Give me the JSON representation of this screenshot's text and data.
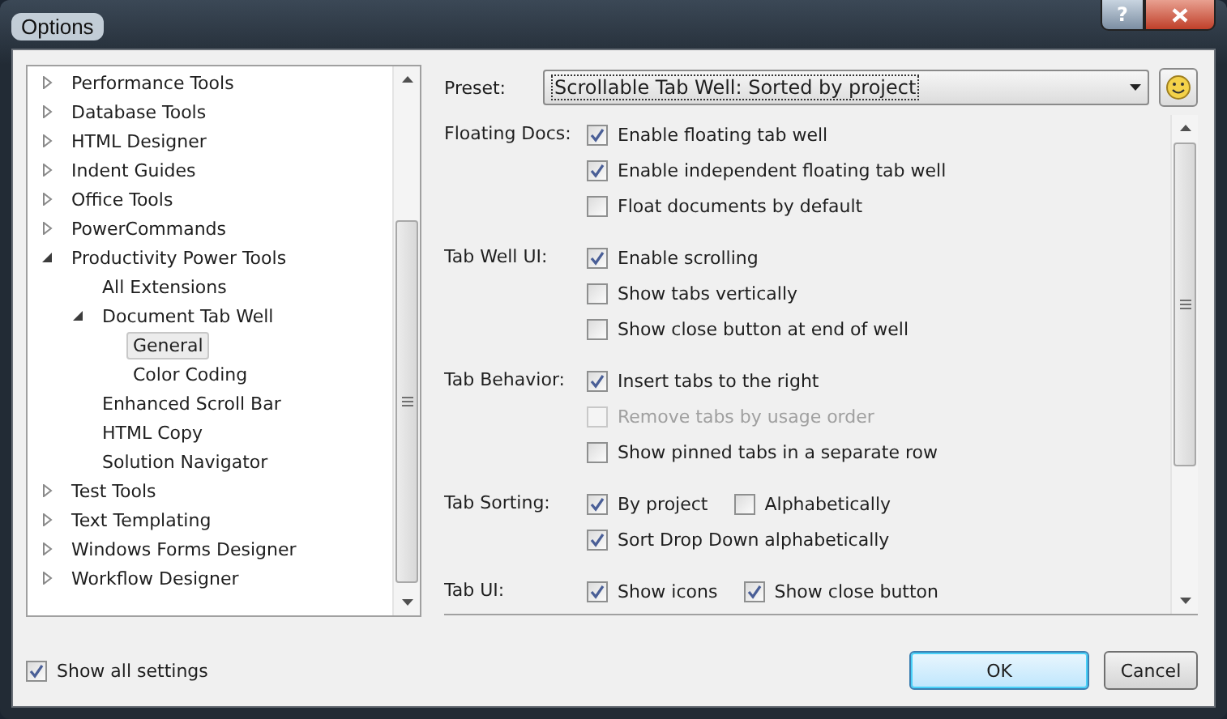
{
  "window": {
    "title": "Options",
    "help_button": "?"
  },
  "tree": [
    {
      "label": "Performance Tools",
      "expanded": false,
      "selected": false
    },
    {
      "label": "Database Tools",
      "expanded": false,
      "selected": false
    },
    {
      "label": "HTML Designer",
      "expanded": false,
      "selected": false
    },
    {
      "label": "Indent Guides",
      "expanded": false,
      "selected": false
    },
    {
      "label": "Office Tools",
      "expanded": false,
      "selected": false
    },
    {
      "label": "PowerCommands",
      "expanded": false,
      "selected": false
    },
    {
      "label": "Productivity Power Tools",
      "expanded": true,
      "selected": false,
      "children": [
        {
          "label": "All Extensions",
          "selected": false
        },
        {
          "label": "Document Tab Well",
          "expanded": true,
          "selected": false,
          "children": [
            {
              "label": "General",
              "selected": true
            },
            {
              "label": "Color Coding",
              "selected": false
            }
          ]
        },
        {
          "label": "Enhanced Scroll Bar",
          "selected": false
        },
        {
          "label": "HTML Copy",
          "selected": false
        },
        {
          "label": "Solution Navigator",
          "selected": false
        }
      ]
    },
    {
      "label": "Test Tools",
      "expanded": false,
      "selected": false
    },
    {
      "label": "Text Templating",
      "expanded": false,
      "selected": false
    },
    {
      "label": "Windows Forms Designer",
      "expanded": false,
      "selected": false
    },
    {
      "label": "Workflow Designer",
      "expanded": false,
      "selected": false
    }
  ],
  "show_all_settings": {
    "label": "Show all settings",
    "checked": true
  },
  "preset": {
    "label": "Preset:",
    "value": "Scrollable Tab Well: Sorted by project"
  },
  "groups": [
    {
      "label": "Floating Docs:",
      "rows": [
        [
          {
            "label": "Enable floating tab well",
            "checked": true,
            "disabled": false
          }
        ],
        [
          {
            "label": "Enable independent floating tab well",
            "checked": true,
            "disabled": false
          }
        ],
        [
          {
            "label": "Float documents by default",
            "checked": false,
            "disabled": false
          }
        ]
      ]
    },
    {
      "label": "Tab Well UI:",
      "rows": [
        [
          {
            "label": "Enable scrolling",
            "checked": true,
            "disabled": false
          }
        ],
        [
          {
            "label": "Show tabs vertically",
            "checked": false,
            "disabled": false
          }
        ],
        [
          {
            "label": "Show close button at end of well",
            "checked": false,
            "disabled": false
          }
        ]
      ]
    },
    {
      "label": "Tab Behavior:",
      "rows": [
        [
          {
            "label": "Insert tabs to the right",
            "checked": true,
            "disabled": false
          }
        ],
        [
          {
            "label": "Remove tabs by usage order",
            "checked": false,
            "disabled": true
          }
        ],
        [
          {
            "label": "Show pinned tabs in a separate row",
            "checked": false,
            "disabled": false
          }
        ]
      ]
    },
    {
      "label": "Tab Sorting:",
      "rows": [
        [
          {
            "label": "By project",
            "checked": true,
            "disabled": false
          },
          {
            "label": "Alphabetically",
            "checked": false,
            "disabled": false
          }
        ],
        [
          {
            "label": "Sort Drop Down alphabetically",
            "checked": true,
            "disabled": false
          }
        ]
      ]
    },
    {
      "label": "Tab UI:",
      "rows": [
        [
          {
            "label": "Show icons",
            "checked": true,
            "disabled": false
          },
          {
            "label": "Show close button",
            "checked": true,
            "disabled": false
          }
        ]
      ]
    }
  ],
  "buttons": [
    {
      "label": "OK",
      "default": true
    },
    {
      "label": "Cancel",
      "default": false
    }
  ]
}
